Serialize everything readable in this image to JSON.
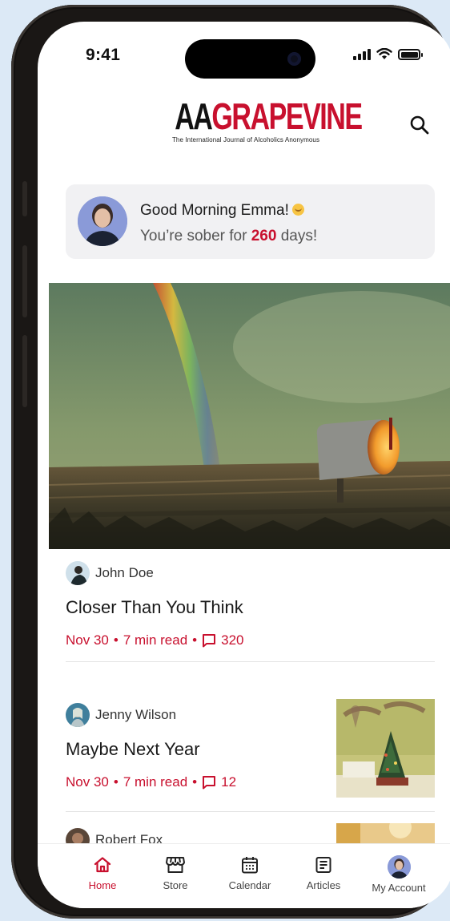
{
  "status_bar": {
    "time": "9:41"
  },
  "brand": {
    "logo_aa": "AA",
    "logo_grapevine": "GRAPEVINE",
    "tagline": "The International Journal of Alcoholics Anonymous",
    "search_icon": "search-icon"
  },
  "greeting": {
    "title": "Good Morning Emma!",
    "sober_prefix": "You’re sober for",
    "sober_days": "260",
    "sober_suffix": "days!"
  },
  "articles": [
    {
      "author": "John Doe",
      "title": "Closer Than You Think",
      "date": "Nov 30",
      "read_time": "7 min read",
      "comments": "320"
    },
    {
      "author": "Jenny Wilson",
      "title": "Maybe Next Year",
      "date": "Nov 30",
      "read_time": "7 min read",
      "comments": "12"
    },
    {
      "author": "Robert Fox"
    }
  ],
  "tabs": [
    {
      "label": "Home",
      "icon": "home-icon",
      "active": true
    },
    {
      "label": "Store",
      "icon": "store-icon"
    },
    {
      "label": "Calendar",
      "icon": "calendar-icon"
    },
    {
      "label": "Articles",
      "icon": "articles-icon"
    },
    {
      "label": "My Account",
      "icon": "avatar"
    }
  ],
  "colors": {
    "accent": "#c8102e",
    "background": "#dce9f6",
    "card": "#f1f1f3"
  }
}
